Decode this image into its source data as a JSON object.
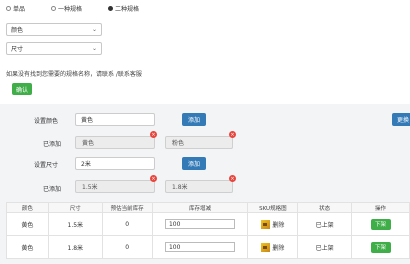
{
  "spec_type": {
    "options": [
      "单品",
      "一种规格",
      "二种规格"
    ],
    "selected_index": 2
  },
  "selects": {
    "first": "颜色",
    "second": "尺寸"
  },
  "hint": "如果没有找到您需要的规格名称，请联系 /联系客服",
  "confirm_button": "确认",
  "color_row": {
    "label": "设置颜色",
    "input_value": "黄色",
    "add_button": "添加",
    "side_button": "更换"
  },
  "color_added": {
    "label": "已添加",
    "tags": [
      "黄色",
      "粉色"
    ]
  },
  "size_row": {
    "label": "设置尺寸",
    "input_value": "2米",
    "add_button": "添加"
  },
  "size_added": {
    "label": "已添加",
    "tags": [
      "1.5米",
      "1.8米"
    ]
  },
  "table": {
    "headers": [
      "颜色",
      "尺寸",
      "预估当前库存",
      "库存增减",
      "SKU规格图",
      "状态",
      "操作"
    ],
    "rows": [
      {
        "color": "黄色",
        "size": "1.5米",
        "stock": "0",
        "delta": "100",
        "sku": "删除",
        "status": "已上架",
        "action": "下架"
      },
      {
        "color": "黄色",
        "size": "1.8米",
        "stock": "0",
        "delta": "100",
        "sku": "删除",
        "status": "已上架",
        "action": "下架"
      }
    ]
  },
  "colors": {
    "green": "#3fae49",
    "blue": "#337ab7",
    "red_badge": "#e8453c",
    "panel_bg": "#f3f4f6"
  }
}
